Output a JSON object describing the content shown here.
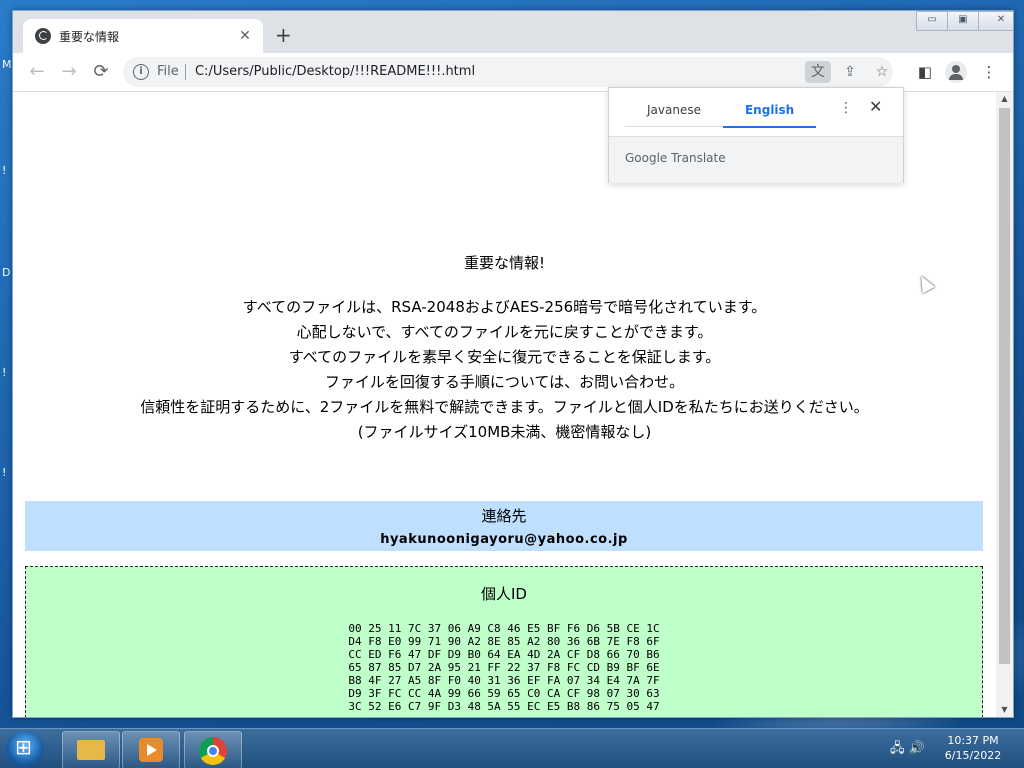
{
  "desktop": {
    "edge_chars": [
      "M",
      "!",
      "D",
      "!",
      "!"
    ]
  },
  "browser": {
    "tab_title": "重要な情報",
    "tab_close": "✕",
    "new_tab": "+",
    "window_controls": {
      "minimize": "▭",
      "restore": "▣",
      "close": "✕"
    },
    "nav": {
      "back": "←",
      "forward": "→",
      "reload": "⟳"
    },
    "omnibox": {
      "info": "i",
      "scheme_label": "File",
      "url": "C:/Users/Public/Desktop/!!!README!!!.html"
    },
    "icons": [
      "translate-icon",
      "share-icon",
      "star-icon",
      "sidepanel-icon",
      "profile-icon",
      "menu-icon"
    ]
  },
  "translate_popup": {
    "tabs": [
      "Javanese",
      "English"
    ],
    "active_tab": "English",
    "menu": "⋮",
    "close": "✕",
    "brand": "Google Translate"
  },
  "page": {
    "heading": "重要な情報!",
    "lines": [
      "すべてのファイルは、RSA-2048およびAES-256暗号で暗号化されています。",
      "心配しないで、すべてのファイルを元に戻すことができます。",
      "すべてのファイルを素早く安全に復元できることを保証します。",
      "ファイルを回復する手順については、お問い合わせ。",
      "信頼性を証明するために、2ファイルを無料で解読できます。ファイルと個人IDを私たちにお送りください。",
      "(ファイルサイズ10MB未満、機密情報なし)"
    ],
    "contact": {
      "heading": "連絡先",
      "email": "hyakunoonigayoru@yahoo.co.jp"
    },
    "personal_id": {
      "heading": "個人ID",
      "hex": "00 25 11 7C 37 06 A9 C8 46 E5 BF F6 D6 5B CE 1C\nD4 F8 E0 99 71 90 A2 8E 85 A2 80 36 6B 7E F8 6F\nCC ED F6 47 DF D9 B0 64 EA 4D 2A CF D8 66 70 B6\n65 87 85 D7 2A 95 21 FF 22 37 F8 FC CD B9 BF 6E\nB8 4F 27 A5 8F F0 40 31 36 EF FA 07 34 E4 7A 7F\nD9 3F FC CC 4A 99 66 59 65 C0 CA CF 98 07 30 63\n3C 52 E6 C7 9F D3 48 5A 55 EC E5 B8 86 75 05 47"
    }
  },
  "taskbar": {
    "time": "10:37 PM",
    "date": "6/15/2022"
  }
}
